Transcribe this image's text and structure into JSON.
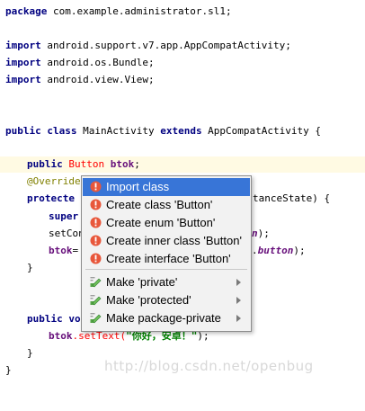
{
  "code": {
    "package_kw": "package",
    "package_name": " com.example.administrator.sl1;",
    "import_kw": "import",
    "imports": [
      " android.support.v7.app.AppCompatActivity;",
      " android.os.Bundle;",
      " android.view.View;"
    ],
    "class_decl_kw1": "public class",
    "class_name": " MainActivity ",
    "class_extends_kw": "extends",
    "class_parent": " AppCompatActivity {",
    "field_kw": "public",
    "field_type": " Button",
    "field_name": " btok",
    "field_semicolon": ";",
    "override": "@Override",
    "protected_kw": "protecte",
    "oncreate_tail": "tanceState) {",
    "super_kw": "super",
    "setcontent": "setCon",
    "setcontent_tail": "n);",
    "btok_assign_prefix": "btok",
    "btok_assign_eq": "=",
    "btok_assign_tail_button": "button",
    "btok_assign_tail_end": ");",
    "close_brace_1": "}",
    "public_void": "public vo",
    "settext_obj": "btok",
    "settext_method": ".setText(",
    "settext_string": "\"你好，安卓！\"",
    "settext_end": ");",
    "close_brace_2": "}",
    "close_brace_3": "}"
  },
  "popup": {
    "items": [
      {
        "label": "Import class",
        "selected": true,
        "submenu": false
      },
      {
        "label": "Create class 'Button'",
        "selected": false,
        "submenu": false
      },
      {
        "label": "Create enum 'Button'",
        "selected": false,
        "submenu": false
      },
      {
        "label": "Create inner class 'Button'",
        "selected": false,
        "submenu": false
      },
      {
        "label": "Create interface 'Button'",
        "selected": false,
        "submenu": false
      },
      {
        "label": "Make 'private'",
        "selected": false,
        "submenu": true
      },
      {
        "label": "Make 'protected'",
        "selected": false,
        "submenu": true
      },
      {
        "label": "Make package-private",
        "selected": false,
        "submenu": true
      }
    ]
  },
  "watermark": "http://blog.csdn.net/openbug",
  "colors": {
    "keyword": "#000080",
    "unresolved": "#ff0000",
    "annotation": "#808000",
    "field": "#660e7a",
    "string": "#008000",
    "selection": "#3875d7",
    "current_line": "#fffae3"
  }
}
